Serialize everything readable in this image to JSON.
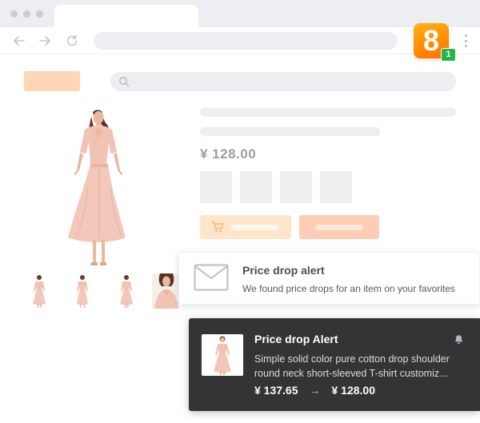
{
  "browser": {
    "extension": {
      "icon_text": "8",
      "badge_count": "1",
      "name": "extension-logo-icon"
    }
  },
  "product": {
    "price": "¥ 128.00",
    "image": "pink-dress-photo"
  },
  "alert": {
    "title": "Price drop alert",
    "message": "We found price drops for an item on your favorites"
  },
  "notification": {
    "title": "Price drop Alert",
    "description_line1": "Simple solid color pure cotton drop shoulder",
    "description_line2": "round neck short-sleeved T-shirt customiz...",
    "old_price": "¥ 137.65",
    "arrow": "→",
    "new_price": "¥ 128.00"
  },
  "colors": {
    "accent_orange": "#ff8a00",
    "badge_green": "#27b54a",
    "cart_button": "#ffe6ca",
    "buy_button": "#ffcdb6",
    "notification_bg": "#333436"
  }
}
